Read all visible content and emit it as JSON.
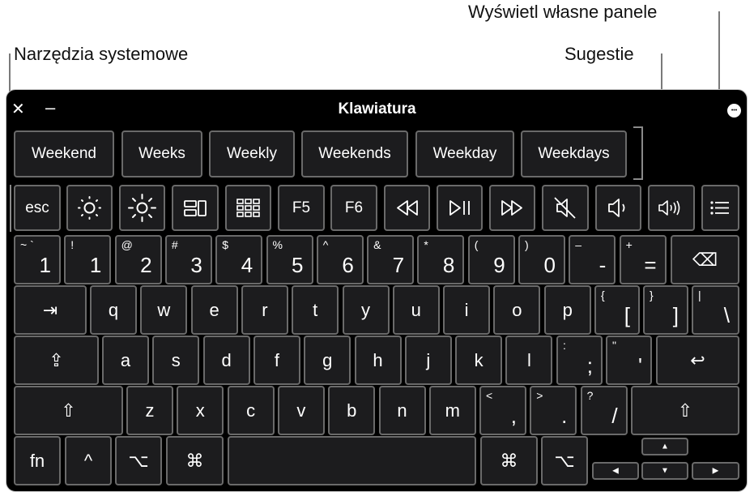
{
  "callouts": {
    "system_tools": "Narzędzia systemowe",
    "suggestions": "Sugestie",
    "custom_panels": "Wyświetl własne panele"
  },
  "window": {
    "title": "Klawiatura"
  },
  "suggestions": [
    "Weekend",
    "Weeks",
    "Weekly",
    "Weekends",
    "Weekday",
    "Weekdays"
  ],
  "toolbar": {
    "esc": "esc",
    "f5": "F5",
    "f6": "F6"
  },
  "number_row": [
    {
      "top": "~ `",
      "main": "1"
    },
    {
      "top": "!",
      "main": "1"
    },
    {
      "top": "@",
      "main": "2"
    },
    {
      "top": "#",
      "main": "3"
    },
    {
      "top": "$",
      "main": "4"
    },
    {
      "top": "%",
      "main": "5"
    },
    {
      "top": "^",
      "main": "6"
    },
    {
      "top": "&",
      "main": "7"
    },
    {
      "top": "*",
      "main": "8"
    },
    {
      "top": "(",
      "main": "9"
    },
    {
      "top": ")",
      "main": "0"
    },
    {
      "top": "–",
      "main": "-"
    },
    {
      "top": "+",
      "main": "="
    }
  ],
  "row_q": [
    "q",
    "w",
    "e",
    "r",
    "t",
    "y",
    "u",
    "i",
    "o",
    "p"
  ],
  "row_q_extra": [
    {
      "top": "{",
      "main": "["
    },
    {
      "top": "}",
      "main": "]"
    },
    {
      "top": "|",
      "main": "\\"
    }
  ],
  "row_a": [
    "a",
    "s",
    "d",
    "f",
    "g",
    "h",
    "j",
    "k",
    "l"
  ],
  "row_a_extra": [
    {
      "top": ":",
      "main": ";"
    },
    {
      "top": "\"",
      "main": "'"
    }
  ],
  "row_z": [
    "z",
    "x",
    "c",
    "v",
    "b",
    "n",
    "m"
  ],
  "row_z_extra": [
    {
      "top": "<",
      "main": ","
    },
    {
      "top": ">",
      "main": "."
    },
    {
      "top": "?",
      "main": "/"
    }
  ],
  "bottom": {
    "fn": "fn",
    "ctrl": "^",
    "opt": "⌥",
    "cmd": "⌘"
  },
  "symbols": {
    "tab": "⇥",
    "caps": "⇪",
    "shift": "⇧",
    "return": "↩",
    "delete": "⌫",
    "arrow_up": "▲",
    "arrow_down": "▼",
    "arrow_left": "◀",
    "arrow_right": "▶",
    "close": "✕",
    "minimize": "–",
    "more": "•••"
  }
}
